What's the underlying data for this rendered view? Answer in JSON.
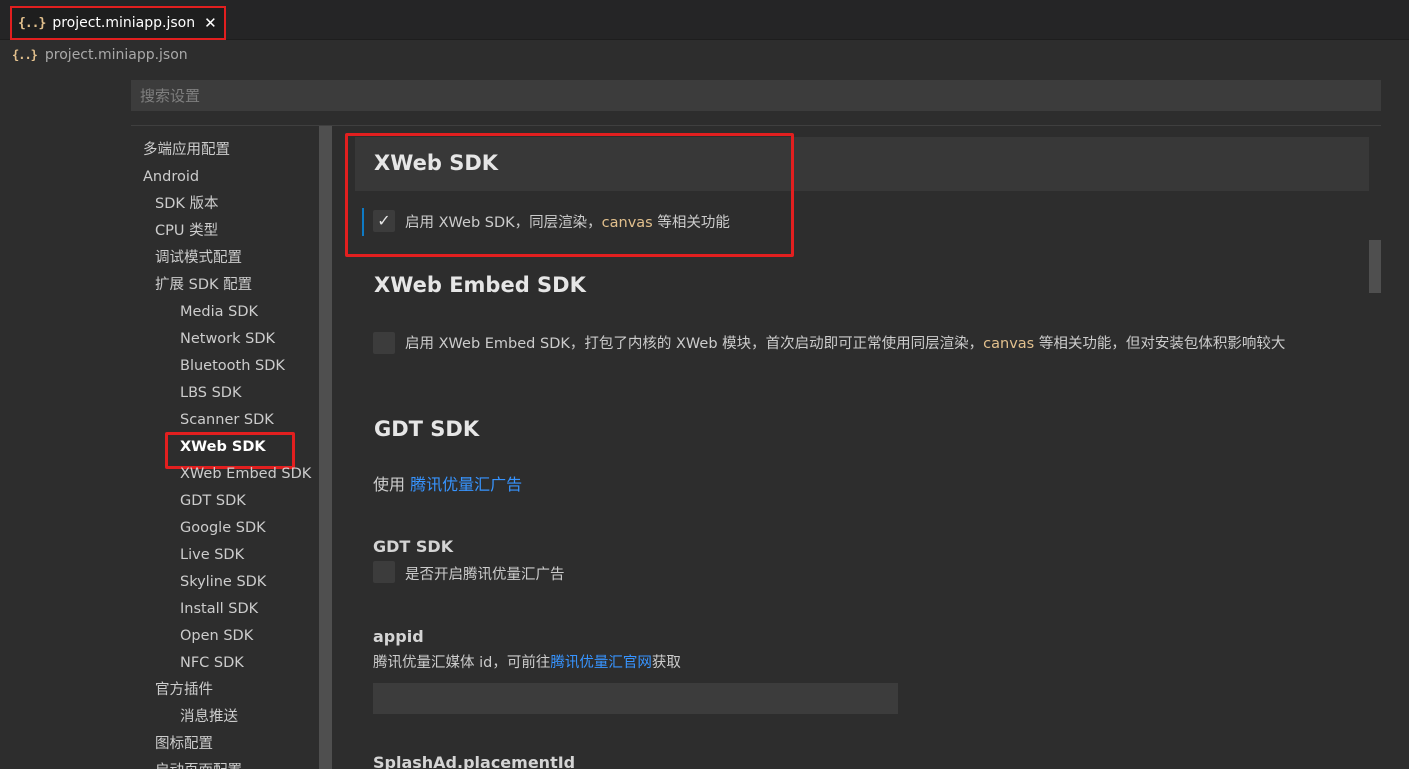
{
  "tab": {
    "label": "project.miniapp.json",
    "icon": "{..}"
  },
  "breadcrumb": {
    "label": "project.miniapp.json",
    "icon": "{..}"
  },
  "search": {
    "placeholder": "搜索设置",
    "value": ""
  },
  "toc": [
    {
      "label": "多端应用配置",
      "level": 0,
      "active": false
    },
    {
      "label": "Android",
      "level": 0,
      "active": false
    },
    {
      "label": "SDK 版本",
      "level": 1,
      "active": false
    },
    {
      "label": "CPU 类型",
      "level": 1,
      "active": false
    },
    {
      "label": "调试模式配置",
      "level": 1,
      "active": false
    },
    {
      "label": "扩展 SDK 配置",
      "level": 1,
      "active": false
    },
    {
      "label": "Media SDK",
      "level": 2,
      "active": false
    },
    {
      "label": "Network SDK",
      "level": 2,
      "active": false
    },
    {
      "label": "Bluetooth SDK",
      "level": 2,
      "active": false
    },
    {
      "label": "LBS SDK",
      "level": 2,
      "active": false
    },
    {
      "label": "Scanner SDK",
      "level": 2,
      "active": false
    },
    {
      "label": "XWeb SDK",
      "level": 2,
      "active": true
    },
    {
      "label": "XWeb Embed SDK",
      "level": 2,
      "active": false
    },
    {
      "label": "GDT SDK",
      "level": 2,
      "active": false
    },
    {
      "label": "Google SDK",
      "level": 2,
      "active": false
    },
    {
      "label": "Live SDK",
      "level": 2,
      "active": false
    },
    {
      "label": "Skyline SDK",
      "level": 2,
      "active": false
    },
    {
      "label": "Install SDK",
      "level": 2,
      "active": false
    },
    {
      "label": "Open SDK",
      "level": 2,
      "active": false
    },
    {
      "label": "NFC SDK",
      "level": 2,
      "active": false
    },
    {
      "label": "官方插件",
      "level": 1,
      "active": false
    },
    {
      "label": "消息推送",
      "level": 2,
      "active": false
    },
    {
      "label": "图标配置",
      "level": 1,
      "active": false
    },
    {
      "label": "启动页面配置",
      "level": 1,
      "active": false
    }
  ],
  "xweb": {
    "title": "XWeb SDK",
    "checked": true,
    "text_before": "启用 XWeb SDK，同层渲染，",
    "code": "canvas",
    "text_after": " 等相关功能"
  },
  "xweb_embed": {
    "title": "XWeb Embed SDK",
    "checked": false,
    "text_before": "启用 XWeb Embed SDK，打包了内核的 XWeb 模块，首次启动即可正常使用同层渲染，",
    "code": "canvas",
    "text_after": " 等相关功能，但对安装包体积影响较大"
  },
  "gdt": {
    "title": "GDT SDK",
    "use_prefix": "使用 ",
    "use_link": "腾讯优量汇广告",
    "setting_label": "GDT SDK",
    "checkbox_text": "是否开启腾讯优量汇广告",
    "checked": false,
    "appid_label": "appid",
    "appid_desc_before": "腾讯优量汇媒体 id，可前往",
    "appid_desc_link": "腾讯优量汇官网",
    "appid_desc_after": "获取",
    "appid_value": "",
    "splash_label": "SplashAd.placementId"
  },
  "check_glyph": "✓",
  "close_glyph": "✕"
}
